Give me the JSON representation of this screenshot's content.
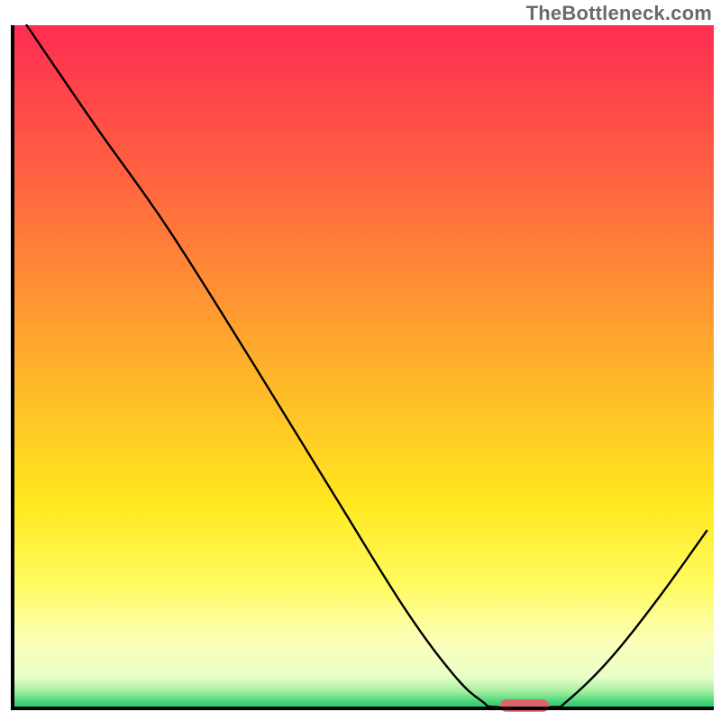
{
  "watermark": "TheBottleneck.com",
  "chart_data": {
    "type": "line",
    "title": "",
    "xlabel": "",
    "ylabel": "",
    "xlim": [
      0,
      100
    ],
    "ylim": [
      0,
      100
    ],
    "axes_visible": false,
    "background_gradient": {
      "stops": [
        {
          "offset": 0.0,
          "color": "#ff2c52"
        },
        {
          "offset": 0.25,
          "color": "#ff6a3f"
        },
        {
          "offset": 0.5,
          "color": "#ffb12a"
        },
        {
          "offset": 0.7,
          "color": "#ffe81f"
        },
        {
          "offset": 0.82,
          "color": "#fffb60"
        },
        {
          "offset": 0.9,
          "color": "#fcffb8"
        },
        {
          "offset": 0.955,
          "color": "#e7ffc8"
        },
        {
          "offset": 0.975,
          "color": "#a3ef9f"
        },
        {
          "offset": 0.99,
          "color": "#49d67a"
        },
        {
          "offset": 1.0,
          "color": "#22c86a"
        }
      ]
    },
    "series": [
      {
        "name": "bottleneck-curve",
        "color": "#000000",
        "width": 2.4,
        "points": [
          {
            "x": 2.0,
            "y": 100.0
          },
          {
            "x": 12.0,
            "y": 85.0
          },
          {
            "x": 22.0,
            "y": 70.5
          },
          {
            "x": 34.0,
            "y": 51.0
          },
          {
            "x": 46.0,
            "y": 31.0
          },
          {
            "x": 56.0,
            "y": 14.5
          },
          {
            "x": 63.0,
            "y": 4.8
          },
          {
            "x": 67.0,
            "y": 1.0
          },
          {
            "x": 69.0,
            "y": 0.2
          },
          {
            "x": 77.0,
            "y": 0.2
          },
          {
            "x": 79.0,
            "y": 1.0
          },
          {
            "x": 85.0,
            "y": 7.0
          },
          {
            "x": 92.0,
            "y": 16.0
          },
          {
            "x": 99.0,
            "y": 26.0
          }
        ]
      }
    ],
    "marker": {
      "name": "optimal-range",
      "shape": "pill",
      "color": "#e1626c",
      "x_start": 69.5,
      "x_end": 76.5,
      "y": 0.4,
      "thickness": 1.8
    }
  }
}
